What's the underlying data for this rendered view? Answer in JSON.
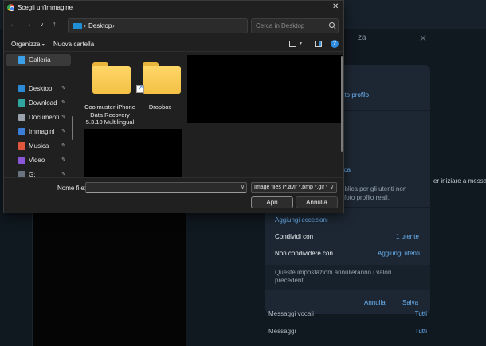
{
  "dialog": {
    "title": "Scegli un'immagine",
    "close_glyph": "✕",
    "nav": {
      "back": "←",
      "forward": "→",
      "recent": "∨",
      "up": "↑"
    },
    "address": {
      "path": "Desktop",
      "sep": "›",
      "dropdown": "∨",
      "refresh": "⟳"
    },
    "search_placeholder": "Cerca in Desktop",
    "toolbar": {
      "organize": "Organizza",
      "new_folder": "Nuova cartella",
      "caret": "▾"
    },
    "sidebar": {
      "items": [
        {
          "label": "Galleria",
          "icon": "gallery-icon",
          "color": "#3aa0e8"
        },
        {
          "label": "Desktop",
          "icon": "desktop-icon",
          "color": "#2b8ad8"
        },
        {
          "label": "Download",
          "icon": "download-icon",
          "color": "#2fa6a0"
        },
        {
          "label": "Documenti",
          "icon": "documents-icon",
          "color": "#9aa3ad"
        },
        {
          "label": "Immagini",
          "icon": "pictures-icon",
          "color": "#3a7ed8"
        },
        {
          "label": "Musica",
          "icon": "music-icon",
          "color": "#e0573e"
        },
        {
          "label": "Video",
          "icon": "video-icon",
          "color": "#8b55d8"
        },
        {
          "label": "G:",
          "icon": "drive-icon",
          "color": "#6a7480"
        }
      ],
      "pin_glyph": "📌"
    },
    "files": [
      {
        "label": "Coolmuster iPhone Data Recovery 5.3.10 Multilingual",
        "shortcut": false
      },
      {
        "label": "Dropbox",
        "shortcut": true
      }
    ],
    "filename": {
      "label": "Nome file:",
      "value": ""
    },
    "filter": "Image files (*.avif *.bmp *.gif *.ic",
    "open_button": "Apri",
    "cancel_button": "Annulla"
  },
  "background": {
    "privacy_title_fragment": "za",
    "close_glyph": "✕",
    "hint_fragment": "er iniziare a messa",
    "photo_fragment": "oto profilo",
    "public_fragment": "lica",
    "desc_fragment_1": "bblica per gli utenti non",
    "desc_fragment_2": "foto profilo reali.",
    "exceptions_link": "Aggiungi eccezioni",
    "share_with": {
      "label": "Condividi con",
      "value": "1 utente"
    },
    "dont_share_with": {
      "label": "Non condividere con",
      "value": "Aggiungi utenti"
    },
    "note": "Queste impostazioni annulleranno i valori precedenti.",
    "cancel": "Annulla",
    "save": "Salva",
    "voice_messages": {
      "label": "Messaggi vocali",
      "value": "Tutti"
    },
    "messages": {
      "label": "Messaggi",
      "value": "Tutti"
    }
  },
  "colors": {
    "accent": "#6ab2f2",
    "folder": "#f3c145",
    "dialog_bg": "#202020"
  }
}
